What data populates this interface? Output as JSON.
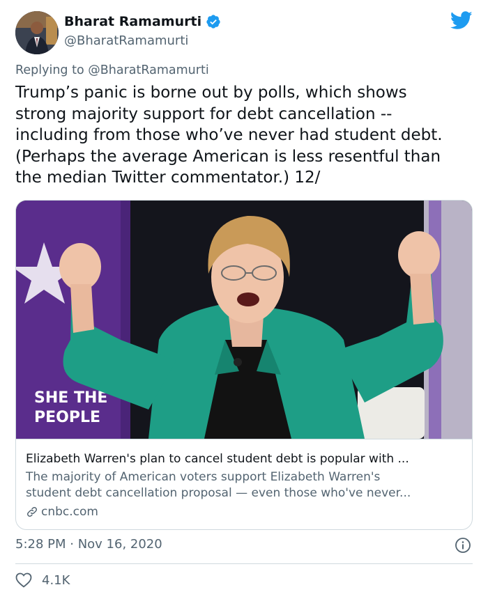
{
  "author": {
    "name": "Bharat Ramamurti",
    "handle": "@BharatRamamurti",
    "verified": true
  },
  "reply": {
    "prefix": "Replying to",
    "mention": "@BharatRamamurti"
  },
  "tweet": {
    "lines": [
      "Trump’s panic is borne out by polls, which shows",
      "strong majority support for debt cancellation --",
      "including from those who’ve never had student debt.",
      "(Perhaps the average American is less resentful than",
      "the median Twitter commentator.) 12/"
    ]
  },
  "card": {
    "title": "Elizabeth Warren's plan to cancel student debt is popular with ...",
    "description_lines": [
      "The majority of American voters support Elizabeth Warren's",
      "student debt cancellation proposal — even those who've never..."
    ],
    "domain": "cnbc.com",
    "image": {
      "description": "Woman in teal blazer raising both fists on stage",
      "backdrop_text": [
        "SHE THE",
        "PEOPLE"
      ]
    }
  },
  "meta": {
    "timestamp": "5:28 PM · Nov 16, 2020",
    "like_count": "4.1K"
  },
  "colors": {
    "twitter_blue": "#1d9bf0",
    "secondary_text": "#536471",
    "border": "#cfd9de",
    "blazer": "#1e9e86",
    "backdrop_purple": "#5a2d8c"
  },
  "icons": {
    "brand": "twitter-bird-icon",
    "verified": "verified-badge-icon",
    "link": "link-icon",
    "info": "info-icon",
    "like": "heart-icon"
  }
}
